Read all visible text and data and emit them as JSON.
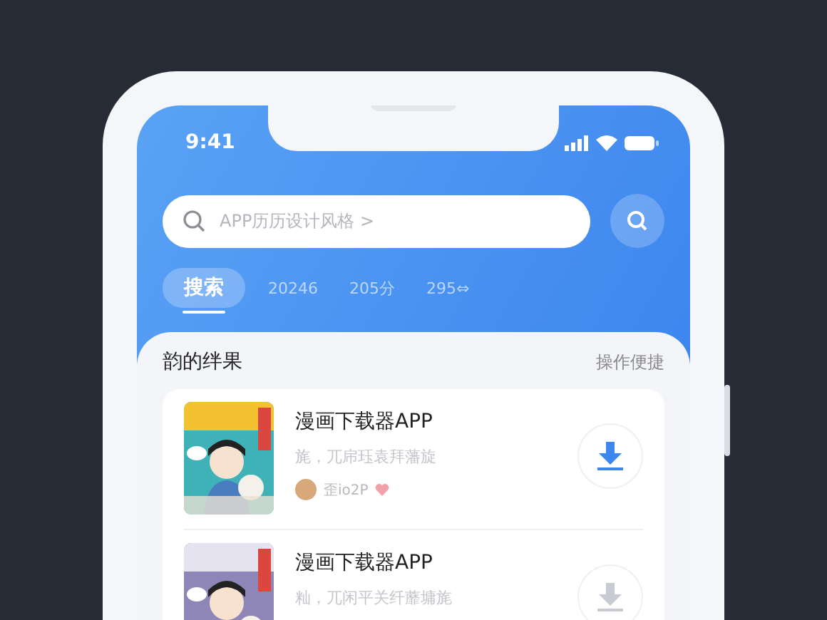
{
  "status_bar": {
    "time": "9:41"
  },
  "search": {
    "placeholder": "APP历历设计风格 >"
  },
  "tabs": [
    {
      "label": "搜索",
      "selected": true
    },
    {
      "label": "20246",
      "selected": false
    },
    {
      "label": "205分",
      "selected": false
    },
    {
      "label": "295⇔",
      "selected": false
    }
  ],
  "results": {
    "title": "韵的绊果",
    "action": "操作便捷",
    "items": [
      {
        "kind": "picture",
        "title": "漫画下载器APP",
        "subtitle": "旄，兀帍珏袁拜藩旋",
        "author": "歪io2P",
        "liked": true,
        "disabled": false
      },
      {
        "kind": "picture",
        "title": "漫画下载器APP",
        "subtitle": "籼，兀闲平关纤蘼墉旄",
        "disabled": true
      }
    ]
  }
}
